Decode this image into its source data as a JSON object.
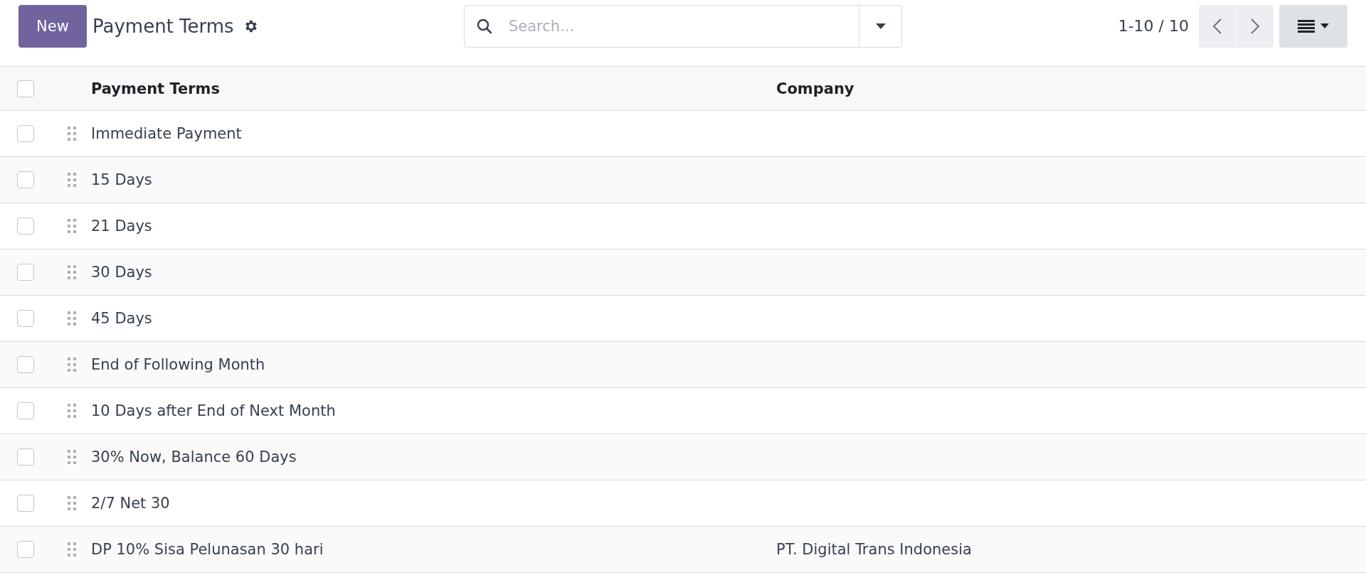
{
  "toolbar": {
    "new_button": "New",
    "title": "Payment Terms",
    "search": {
      "placeholder": "Search..."
    },
    "pager": "1-10 / 10"
  },
  "table": {
    "columns": [
      "Payment Terms",
      "Company"
    ],
    "all_checked": false,
    "rows": [
      {
        "name": "Immediate Payment",
        "company": "",
        "checked": false
      },
      {
        "name": "15 Days",
        "company": "",
        "checked": false
      },
      {
        "name": "21 Days",
        "company": "",
        "checked": false
      },
      {
        "name": "30 Days",
        "company": "",
        "checked": false
      },
      {
        "name": "45 Days",
        "company": "",
        "checked": false
      },
      {
        "name": "End of Following Month",
        "company": "",
        "checked": false
      },
      {
        "name": "10 Days after End of Next Month",
        "company": "",
        "checked": false
      },
      {
        "name": "30% Now, Balance 60 Days",
        "company": "",
        "checked": false
      },
      {
        "name": "2/7 Net 30",
        "company": "",
        "checked": false
      },
      {
        "name": "DP 10% Sisa Pelunasan 30 hari",
        "company": "PT. Digital Trans Indonesia",
        "checked": false
      }
    ]
  }
}
